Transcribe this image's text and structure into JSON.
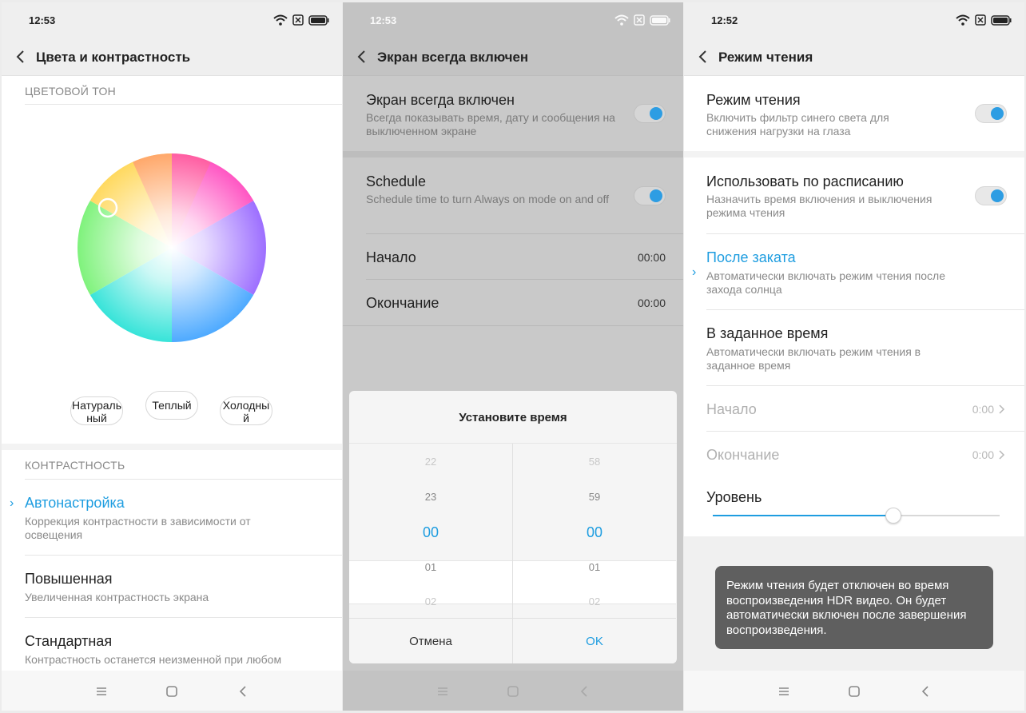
{
  "left": {
    "status_time": "12:53",
    "title": "Цвета и контрастность",
    "color_tone_label": "ЦВЕТОВОЙ ТОН",
    "tone_buttons": [
      "Натураль ный",
      "Теплый",
      "Холодны й"
    ],
    "contrast_label": "КОНТРАСТНОСТЬ",
    "options": [
      {
        "title": "Автонастройка",
        "subtitle": "Коррекция контрастности в зависимости от освещения",
        "selected": true
      },
      {
        "title": "Повышенная",
        "subtitle": "Увеличенная контрастность экрана",
        "selected": false
      },
      {
        "title": "Стандартная",
        "subtitle": "Контрастность останется неизменной при любом",
        "selected": false
      }
    ]
  },
  "middle": {
    "status_time": "12:53",
    "title": "Экран всегда включен",
    "aod": {
      "title": "Экран всегда включен",
      "subtitle": "Всегда показывать время, дату и сообщения на выключенном экране",
      "enabled": true
    },
    "schedule": {
      "title": "Schedule",
      "subtitle": "Schedule time to turn Always on mode on and off",
      "enabled": true
    },
    "start": {
      "label": "Начало",
      "value": "00:00"
    },
    "end": {
      "label": "Окончание",
      "value": "00:00"
    },
    "dialog": {
      "title": "Установите время",
      "hours": [
        "22",
        "23",
        "00",
        "01",
        "02"
      ],
      "minutes": [
        "58",
        "59",
        "00",
        "01",
        "02"
      ],
      "cancel": "Отмена",
      "ok": "OK"
    }
  },
  "right": {
    "status_time": "12:52",
    "title": "Режим чтения",
    "reading": {
      "title": "Режим чтения",
      "subtitle": "Включить фильтр синего света для снижения нагрузки на глаза",
      "enabled": true
    },
    "schedule": {
      "title": "Использовать по расписанию",
      "subtitle": "Назначить время включения и выключения режима чтения",
      "enabled": true
    },
    "after_sunset": {
      "title": "После заката",
      "subtitle": "Автоматически включать режим чтения после захода солнца",
      "selected": true
    },
    "custom_time": {
      "title": "В заданное время",
      "subtitle": "Автоматически включать режим чтения в заданное время"
    },
    "start": {
      "label": "Начало",
      "value": "0:00"
    },
    "end": {
      "label": "Окончание",
      "value": "0:00"
    },
    "level": {
      "label": "Уровень",
      "value": 0.63
    },
    "toast": "Режим чтения будет отключен во время воспроизведения HDR видео. Он будет автоматически включен после завершения воспроизведения."
  },
  "colors": {
    "accent": "#1e9de0",
    "toggle_on": "#2d9de3",
    "toast_bg": "#5f5f5f"
  }
}
